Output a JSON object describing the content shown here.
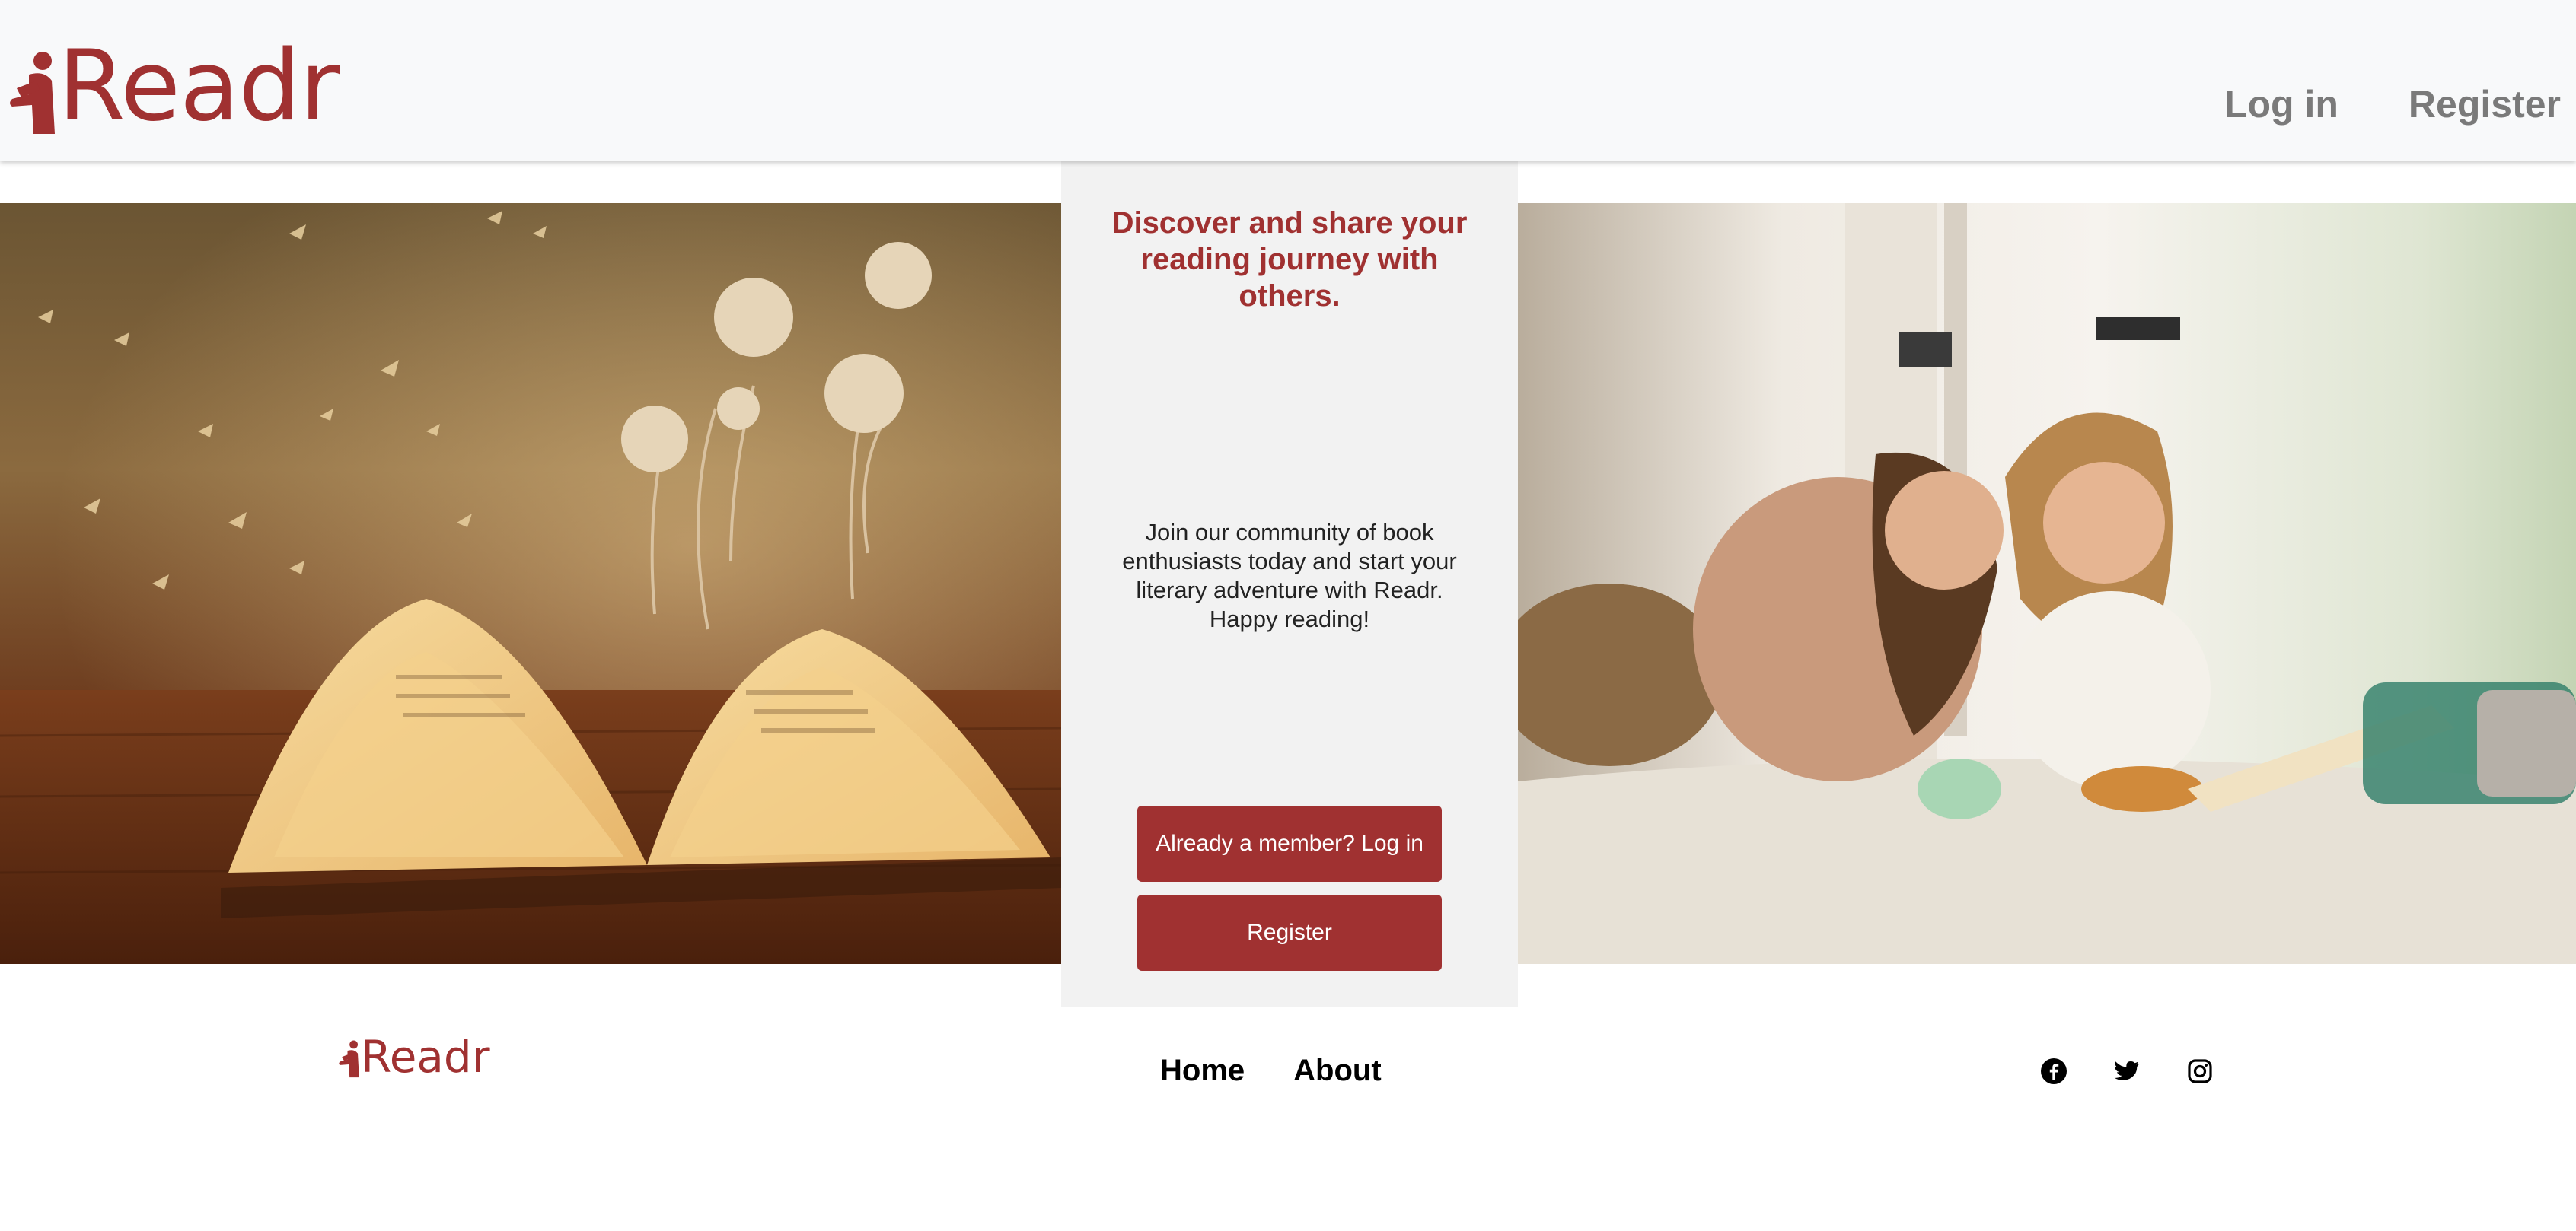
{
  "brand": {
    "name": "Readr",
    "color": "#a03131"
  },
  "header": {
    "nav": {
      "login": "Log in",
      "register": "Register"
    }
  },
  "hero": {
    "tagline": "Discover and share your reading journey with others.",
    "intro": "Join our community of book enthusiasts today and start your literary adventure with Readr. Happy reading!",
    "login_button": "Already a member? Log in",
    "register_button": "Register"
  },
  "footer": {
    "brand": "Readr",
    "nav": {
      "home": "Home",
      "about": "About"
    },
    "social": [
      "facebook-icon",
      "twitter-icon",
      "instagram-icon"
    ]
  },
  "colors": {
    "accent": "#a03131",
    "header_bg": "#f8f9fa",
    "panel_bg": "#f2f2f2",
    "nav_text": "#7a7a7a"
  }
}
